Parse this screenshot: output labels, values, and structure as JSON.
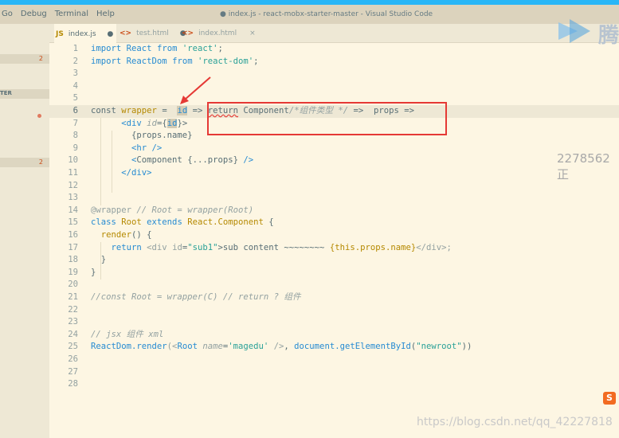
{
  "menu": [
    "Go",
    "Debug",
    "Terminal",
    "Help"
  ],
  "window_title": "● index.js - react-mobx-starter-master - Visual Studio Code",
  "tabs": [
    {
      "label": "index.js",
      "icon": "JS",
      "modified": "●"
    },
    {
      "label": "test.html",
      "icon": "<>",
      "modified": "●"
    },
    {
      "label": "index.html",
      "icon": "<>",
      "modified": "×"
    }
  ],
  "sidebar": {
    "badge_top": "2",
    "section_label": "TER",
    "badge_bottom": "2"
  },
  "lines": [
    {
      "n": "1",
      "tokens": [
        {
          "t": "import ",
          "c": "#268bd2"
        },
        {
          "t": "React ",
          "c": "#268bd2"
        },
        {
          "t": "from ",
          "c": "#268bd2"
        },
        {
          "t": "'react'",
          "c": "#2aa198"
        },
        {
          "t": ";",
          "c": "#586e75"
        }
      ]
    },
    {
      "n": "2",
      "tokens": [
        {
          "t": "import ",
          "c": "#268bd2"
        },
        {
          "t": "ReactDom ",
          "c": "#268bd2"
        },
        {
          "t": "from ",
          "c": "#268bd2"
        },
        {
          "t": "'react-dom'",
          "c": "#2aa198"
        },
        {
          "t": ";",
          "c": "#586e75"
        }
      ]
    },
    {
      "n": "3",
      "tokens": []
    },
    {
      "n": "4",
      "tokens": []
    },
    {
      "n": "5",
      "tokens": []
    },
    {
      "n": "6",
      "tokens": [
        {
          "t": "const ",
          "c": "#586e75"
        },
        {
          "t": "wrapper",
          "c": "#b58900"
        },
        {
          "t": " = ",
          "c": "#586e75"
        },
        {
          "t": " ",
          "c": "#586e75"
        },
        {
          "t": "id",
          "c": "#268bd2",
          "hl": true
        },
        {
          "t": " => ",
          "c": "#586e75"
        },
        {
          "t": "return",
          "c": "#586e75",
          "squiggle": true
        },
        {
          "t": " Component",
          "c": "#586e75"
        },
        {
          "t": "/*组件类型 */",
          "c": "#93a1a1",
          "i": true
        },
        {
          "t": " =>  props =>",
          "c": "#586e75"
        }
      ]
    },
    {
      "n": "7",
      "tokens": [
        {
          "t": "      <div ",
          "c": "#268bd2"
        },
        {
          "t": "id",
          "c": "#93a1a1",
          "i": true
        },
        {
          "t": "={",
          "c": "#586e75"
        },
        {
          "t": "id",
          "c": "#268bd2",
          "hl": true
        },
        {
          "t": "}>",
          "c": "#586e75"
        }
      ]
    },
    {
      "n": "8",
      "tokens": [
        {
          "t": "        {props.name}",
          "c": "#586e75"
        }
      ]
    },
    {
      "n": "9",
      "tokens": [
        {
          "t": "        <hr />",
          "c": "#268bd2"
        }
      ]
    },
    {
      "n": "10",
      "tokens": [
        {
          "t": "        <",
          "c": "#268bd2"
        },
        {
          "t": "Component",
          "c": "#586e75"
        },
        {
          "t": " {...props} ",
          "c": "#586e75"
        },
        {
          "t": "/>",
          "c": "#268bd2"
        }
      ]
    },
    {
      "n": "11",
      "tokens": [
        {
          "t": "      </div>",
          "c": "#268bd2"
        }
      ]
    },
    {
      "n": "12",
      "tokens": []
    },
    {
      "n": "13",
      "tokens": []
    },
    {
      "n": "14",
      "tokens": [
        {
          "t": "@wrapper",
          "c": "#93a1a1"
        },
        {
          "t": " // Root = wrapper(Root)",
          "c": "#93a1a1",
          "i": true
        }
      ]
    },
    {
      "n": "15",
      "tokens": [
        {
          "t": "class ",
          "c": "#268bd2"
        },
        {
          "t": "Root ",
          "c": "#b58900"
        },
        {
          "t": "extends ",
          "c": "#268bd2"
        },
        {
          "t": "React.Component",
          "c": "#b58900"
        },
        {
          "t": " {",
          "c": "#586e75"
        }
      ]
    },
    {
      "n": "16",
      "tokens": [
        {
          "t": "  render",
          "c": "#b58900"
        },
        {
          "t": "() {",
          "c": "#586e75"
        }
      ]
    },
    {
      "n": "17",
      "tokens": [
        {
          "t": "    return ",
          "c": "#268bd2"
        },
        {
          "t": "<div ",
          "c": "#93a1a1"
        },
        {
          "t": "id",
          "c": "#93a1a1"
        },
        {
          "t": "=",
          "c": "#586e75"
        },
        {
          "t": "\"sub1\"",
          "c": "#2aa198"
        },
        {
          "t": ">sub content ~~~~~~~~ ",
          "c": "#586e75"
        },
        {
          "t": "{this.props.name}",
          "c": "#b58900"
        },
        {
          "t": "</div>;",
          "c": "#93a1a1"
        }
      ]
    },
    {
      "n": "18",
      "tokens": [
        {
          "t": "  }",
          "c": "#586e75"
        }
      ]
    },
    {
      "n": "19",
      "tokens": [
        {
          "t": "}",
          "c": "#586e75"
        }
      ]
    },
    {
      "n": "20",
      "tokens": []
    },
    {
      "n": "21",
      "tokens": [
        {
          "t": "//const Root = wrapper(C) // return ? 组件",
          "c": "#93a1a1",
          "i": true
        }
      ]
    },
    {
      "n": "22",
      "tokens": []
    },
    {
      "n": "23",
      "tokens": []
    },
    {
      "n": "24",
      "tokens": [
        {
          "t": "// jsx 组件 xml",
          "c": "#93a1a1",
          "i": true
        }
      ]
    },
    {
      "n": "25",
      "tokens": [
        {
          "t": "ReactDom.render",
          "c": "#268bd2"
        },
        {
          "t": "(<",
          "c": "#93a1a1"
        },
        {
          "t": "Root ",
          "c": "#268bd2"
        },
        {
          "t": "name",
          "c": "#93a1a1",
          "i": true
        },
        {
          "t": "=",
          "c": "#586e75"
        },
        {
          "t": "'magedu'",
          "c": "#2aa198"
        },
        {
          "t": " />",
          "c": "#93a1a1"
        },
        {
          "t": ", ",
          "c": "#586e75"
        },
        {
          "t": "document.getElementById",
          "c": "#268bd2"
        },
        {
          "t": "(",
          "c": "#586e75"
        },
        {
          "t": "\"newroot\"",
          "c": "#2aa198"
        },
        {
          "t": "))",
          "c": "#586e75"
        }
      ]
    },
    {
      "n": "26",
      "tokens": []
    },
    {
      "n": "27",
      "tokens": []
    },
    {
      "n": "28",
      "tokens": []
    }
  ],
  "watermark_logo": "腾",
  "watermark_id": "2278562正",
  "watermark_url": "https://blog.csdn.net/qq_42227818",
  "sogou_icon": "S",
  "colors": {
    "annotation_red": "#e53935",
    "accent_blue": "#29b6f6",
    "editor_bg": "#fdf6e3"
  }
}
